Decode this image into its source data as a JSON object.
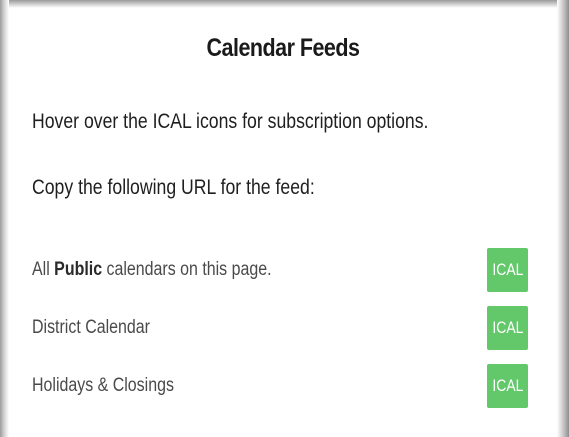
{
  "dialog": {
    "title": "Calendar Feeds",
    "hover_instruction": "Hover over the ICAL icons for subscription options.",
    "copy_instruction": "Copy the following URL for the feed:"
  },
  "feeds": [
    {
      "label_prefix": "All ",
      "label_bold": "Public",
      "label_suffix": " calendars on this page.",
      "button_label": "ICAL"
    },
    {
      "label": "District Calendar",
      "button_label": "ICAL"
    },
    {
      "label": "Holidays & Closings",
      "button_label": "ICAL"
    }
  ],
  "colors": {
    "ical_button": "#62c86a",
    "ical_text": "#ffffff",
    "title_text": "#1a1a1a",
    "feed_label_text": "#4a4a4a"
  }
}
